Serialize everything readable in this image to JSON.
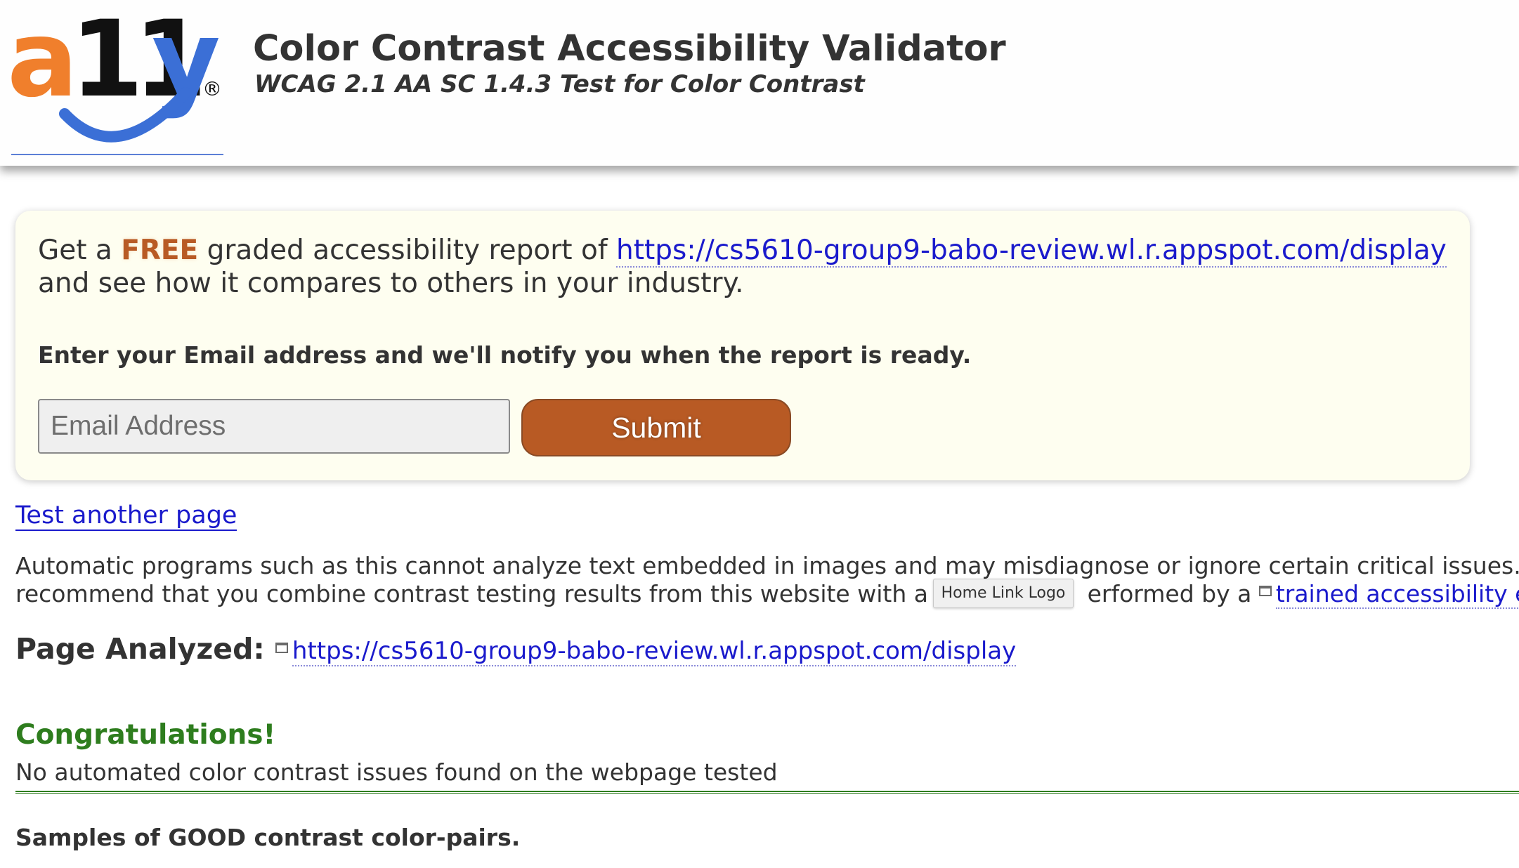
{
  "header": {
    "logo_alt": "a11y",
    "title": "Color Contrast Accessibility Validator",
    "subtitle": "WCAG 2.1 AA SC 1.4.3 Test for Color Contrast"
  },
  "promo": {
    "get_a": "Get a",
    "free": "FREE",
    "graded_text": "graded accessibility report of",
    "report_url": "https://cs5610-group9-babo-review.wl.r.appspot.com/display",
    "line2": "and see how it compares to others in your industry.",
    "notify_text": "Enter your Email address and we'll notify you when the report is ready.",
    "email_placeholder": "Email Address",
    "submit_label": "Submit"
  },
  "test_another_label": "Test another page",
  "disclaimer": {
    "line1": "Automatic programs such as this cannot analyze text embedded in images and may misdiagnose or ignore certain critical issues. We",
    "line2_start": "recommend that you combine contrast testing results from this website with a m",
    "line2_mid": "erformed by a",
    "trained_link": "trained accessibility exp"
  },
  "tooltip_text": "Home Link Logo",
  "analyzed": {
    "label": "Page Analyzed:",
    "url": "https://cs5610-group9-babo-review.wl.r.appspot.com/display"
  },
  "result": {
    "heading": "Congratulations!",
    "message": "No automated color contrast issues found on the webpage tested"
  },
  "samples_heading": "Samples of GOOD contrast color-pairs.",
  "colors": {
    "accent_orange": "#b85a24",
    "logo_orange": "#f07f2c",
    "logo_blue": "#3b6fd6",
    "success_green": "#2e7d1e",
    "link_blue": "#1a1acc",
    "promo_bg": "#fefef0"
  }
}
